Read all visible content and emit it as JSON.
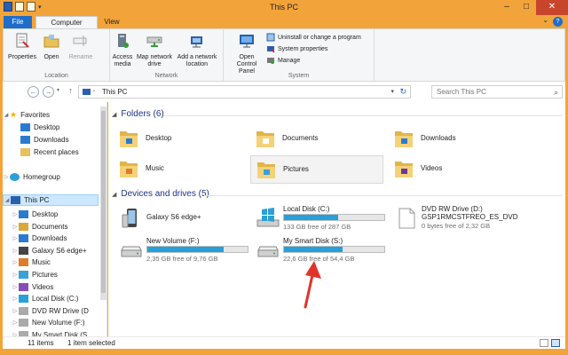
{
  "window": {
    "title": "This PC"
  },
  "tabs": {
    "file": "File",
    "computer": "Computer",
    "view": "View"
  },
  "ribbon": {
    "location": {
      "label": "Location",
      "properties": "Properties",
      "open": "Open",
      "rename": "Rename"
    },
    "network": {
      "label": "Network",
      "access_media": [
        "Access",
        "media"
      ],
      "map_network_drive": [
        "Map network",
        "drive"
      ],
      "add_network_location": [
        "Add a network",
        "location"
      ]
    },
    "system": {
      "label": "System",
      "open_control_panel": [
        "Open Control",
        "Panel"
      ],
      "uninstall": "Uninstall or change a program",
      "system_properties": "System properties",
      "manage": "Manage"
    }
  },
  "address": {
    "path": "This PC",
    "search_placeholder": "Search This PC"
  },
  "nav": {
    "favorites": "Favorites",
    "desktop": "Desktop",
    "downloads": "Downloads",
    "recent_places": "Recent places",
    "homegroup": "Homegroup",
    "this_pc": "This PC",
    "pc_children": [
      "Desktop",
      "Documents",
      "Downloads",
      "Galaxy S6 edge+",
      "Music",
      "Pictures",
      "Videos",
      "Local Disk (C:)",
      "DVD RW Drive (D",
      "New Volume (F:)",
      "My Smart Disk (S"
    ]
  },
  "folders_section": {
    "heading": "Folders (6)",
    "items": [
      "Desktop",
      "Documents",
      "Downloads",
      "Music",
      "Pictures",
      "Videos"
    ]
  },
  "devices_section": {
    "heading": "Devices and drives (5)",
    "galaxy": "Galaxy S6 edge+",
    "local_disk": {
      "name": "Local Disk (C:)",
      "free": "133 GB free of 287 GB",
      "used_fraction": 0.54
    },
    "dvd": {
      "name": "DVD RW Drive (D:)",
      "label": "GSP1RMCSTFREO_ES_DVD",
      "free": "0 bytes free of 2,32 GB"
    },
    "new_volume": {
      "name": "New Volume (F:)",
      "free": "2,35 GB free of 9,76 GB",
      "used_fraction": 0.76
    },
    "smart_disk": {
      "name": "My Smart Disk (S:)",
      "free": "22,6 GB free of 54,4 GB",
      "used_fraction": 0.58
    }
  },
  "status": {
    "count": "11 items",
    "selected": "1 item selected"
  },
  "colors": {
    "accent": "#f2a43a",
    "file_tab": "#1f6ec9",
    "drive_bar": "#26a0da",
    "annotation": "#e0342a"
  }
}
